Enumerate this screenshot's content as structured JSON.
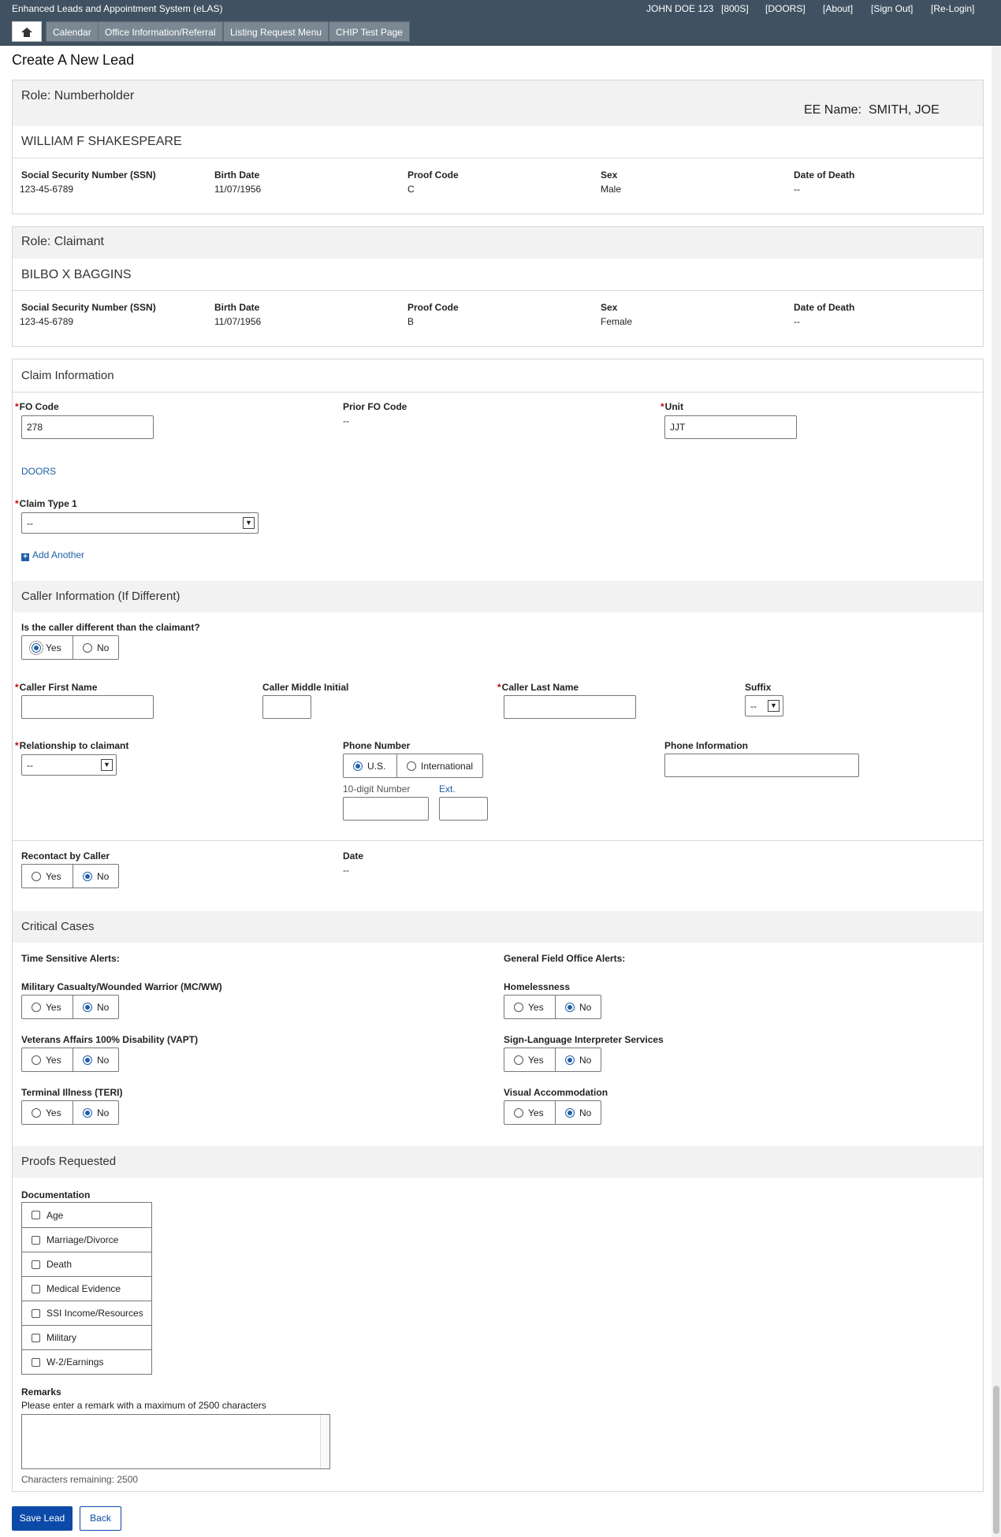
{
  "topbar": {
    "app_title": "Enhanced Leads and Appointment System (eLAS)",
    "user": "JOHN DOE 123",
    "unit_code": "[800S]",
    "doors": "[DOORS]",
    "about": "[About]",
    "sign_out": "[Sign Out]",
    "re_login": "[Re-Login]"
  },
  "nav": {
    "home_icon": "home-icon",
    "items": [
      "Calendar",
      "Office Information/Referral",
      "Listing Request Menu",
      "CHIP Test Page"
    ]
  },
  "page_title": "Create A New Lead",
  "numberholder": {
    "role": "Role: Numberholder",
    "ee_name_label": "EE Name:",
    "ee_name_value": "SMITH, JOE",
    "name": "WILLIAM F SHAKESPEARE",
    "fields": [
      {
        "label": "Social Security Number (SSN)",
        "value": "123-45-6789"
      },
      {
        "label": "Birth Date",
        "value": "11/07/1956"
      },
      {
        "label": "Proof Code",
        "value": "C"
      },
      {
        "label": "Sex",
        "value": "Male"
      },
      {
        "label": "Date of Death",
        "value": "--"
      }
    ]
  },
  "claimant": {
    "role": "Role: Claimant",
    "name": "BILBO X BAGGINS",
    "fields": [
      {
        "label": "Social Security Number (SSN)",
        "value": "123-45-6789"
      },
      {
        "label": "Birth Date",
        "value": "11/07/1956"
      },
      {
        "label": "Proof Code",
        "value": "B"
      },
      {
        "label": "Sex",
        "value": "Female"
      },
      {
        "label": "Date of Death",
        "value": "--"
      }
    ]
  },
  "claim_info": {
    "title": "Claim Information",
    "fo_code_label": "FO Code",
    "fo_code_value": "278",
    "prior_fo_label": "Prior FO Code",
    "prior_fo_value": "--",
    "unit_label": "Unit",
    "unit_value": "JJT",
    "doors_link": "DOORS",
    "claim_type_label": "Claim Type 1",
    "claim_type_value": "--",
    "add_another": "Add Another"
  },
  "caller_info": {
    "title": "Caller Information (If Different)",
    "different_q": "Is the caller different than the claimant?",
    "yes": "Yes",
    "no": "No",
    "first_name_label": "Caller First Name",
    "middle_initial_label": "Caller Middle Initial",
    "last_name_label": "Caller Last Name",
    "suffix_label": "Suffix",
    "suffix_value": "--",
    "relationship_label": "Relationship to claimant",
    "relationship_value": "--",
    "phone_label": "Phone Number",
    "phone_us": "U.S.",
    "phone_intl": "International",
    "ten_digit_label": "10-digit Number",
    "ext_label": "Ext.",
    "phone_info_label": "Phone Information",
    "recontact_label": "Recontact by Caller",
    "date_label": "Date",
    "date_value": "--"
  },
  "critical": {
    "title": "Critical Cases",
    "time_sensitive": "Time Sensitive Alerts:",
    "general_fo": "General Field Office Alerts:",
    "left": [
      {
        "label": "Military Casualty/Wounded Warrior (MC/WW)"
      },
      {
        "label": "Veterans Affairs 100% Disability (VAPT)"
      },
      {
        "label": "Terminal Illness (TERI)"
      }
    ],
    "right": [
      {
        "label": "Homelessness"
      },
      {
        "label": "Sign-Language Interpreter Services"
      },
      {
        "label": "Visual Accommodation"
      }
    ],
    "yes": "Yes",
    "no": "No"
  },
  "proofs": {
    "title": "Proofs Requested",
    "documentation_label": "Documentation",
    "items": [
      "Age",
      "Marriage/Divorce",
      "Death",
      "Medical Evidence",
      "SSI Income/Resources",
      "Military",
      "W-2/Earnings"
    ],
    "remarks_label": "Remarks",
    "remarks_hint": "Please enter a remark with a maximum of 2500 characters",
    "chars_remaining": "Characters remaining: 2500"
  },
  "actions": {
    "save": "Save Lead",
    "back": "Back"
  },
  "colors": {
    "topbar": "#405262",
    "accent_blue": "#1f5fa8",
    "primary_button": "#0b4aa8",
    "required": "#c00"
  }
}
